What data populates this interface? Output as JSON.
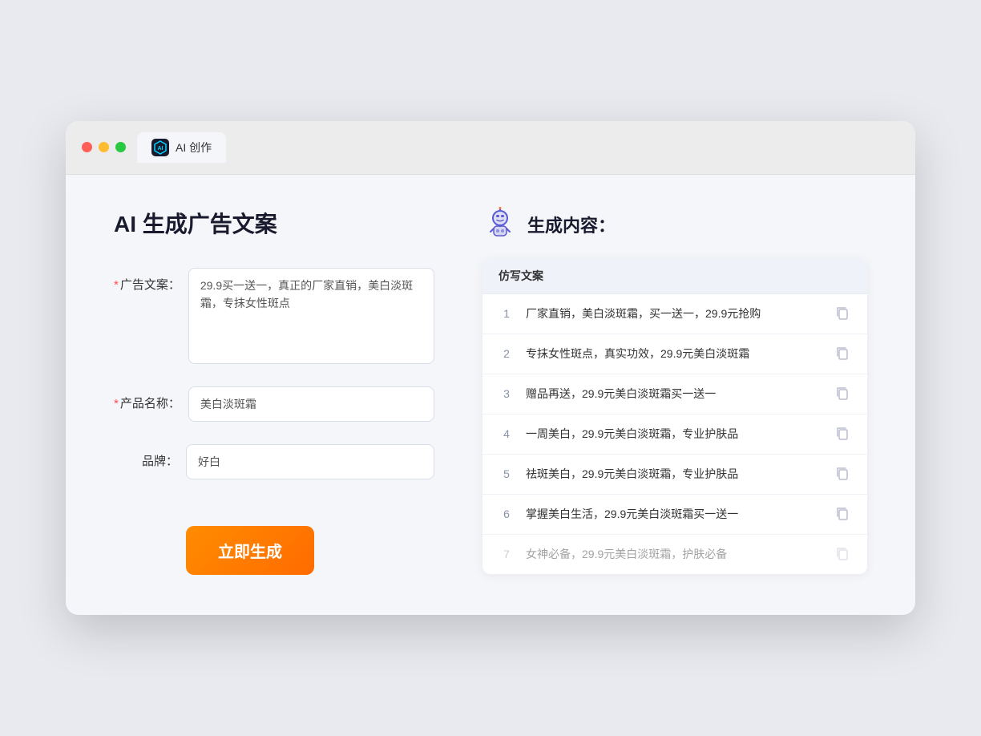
{
  "browser": {
    "tab_label": "AI 创作",
    "tab_icon": "AI"
  },
  "left_panel": {
    "title": "AI 生成广告文案",
    "fields": {
      "ad_copy": {
        "label": "广告文案：",
        "required": true,
        "value": "29.9买一送一，真正的厂家直销，美白淡斑霜，专抹女性斑点",
        "placeholder": ""
      },
      "product_name": {
        "label": "产品名称：",
        "required": true,
        "value": "美白淡斑霜",
        "placeholder": ""
      },
      "brand": {
        "label": "品牌：",
        "required": false,
        "value": "好白",
        "placeholder": ""
      }
    },
    "generate_button": "立即生成"
  },
  "right_panel": {
    "title": "生成内容：",
    "table_header": "仿写文案",
    "results": [
      {
        "id": 1,
        "text": "厂家直销，美白淡斑霜，买一送一，29.9元抢购",
        "faded": false
      },
      {
        "id": 2,
        "text": "专抹女性斑点，真实功效，29.9元美白淡斑霜",
        "faded": false
      },
      {
        "id": 3,
        "text": "赠品再送，29.9元美白淡斑霜买一送一",
        "faded": false
      },
      {
        "id": 4,
        "text": "一周美白，29.9元美白淡斑霜，专业护肤品",
        "faded": false
      },
      {
        "id": 5,
        "text": "祛斑美白，29.9元美白淡斑霜，专业护肤品",
        "faded": false
      },
      {
        "id": 6,
        "text": "掌握美白生活，29.9元美白淡斑霜买一送一",
        "faded": false
      },
      {
        "id": 7,
        "text": "女神必备，29.9元美白淡斑霜，护肤必备",
        "faded": true
      }
    ]
  }
}
